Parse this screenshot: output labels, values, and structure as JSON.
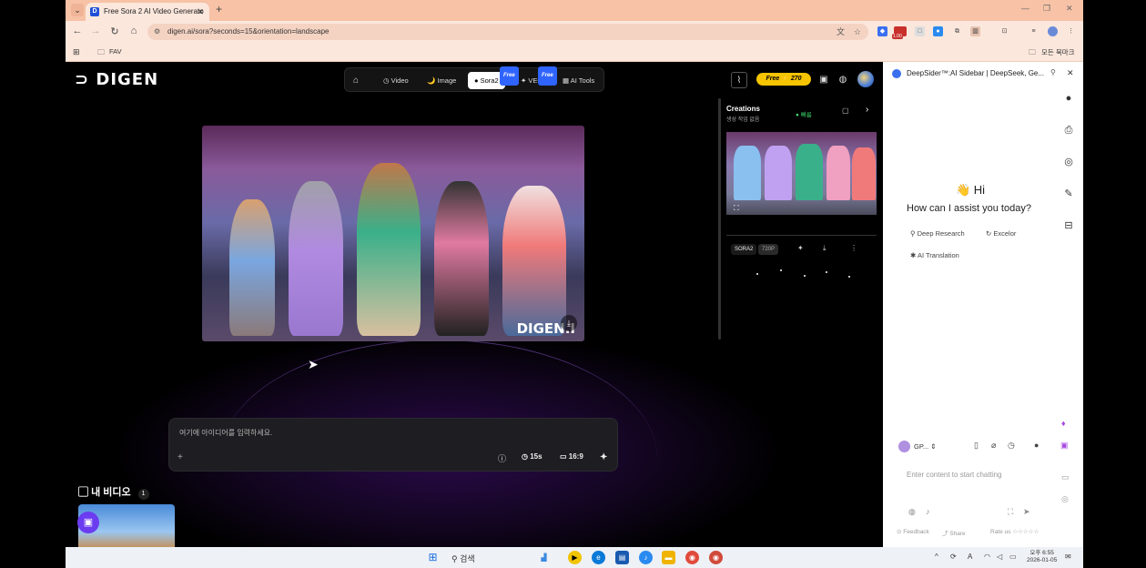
{
  "browser": {
    "tab_title": "Free Sora 2 AI Video Generato",
    "tab_close": "✕",
    "new_tab": "+",
    "url": "digen.ai/sora?seconds=15&orientation=landscape",
    "bookmarks": [
      {
        "label": "FAV"
      }
    ],
    "bookmarks_right": "모든 북마크",
    "ext_badge": "1.00"
  },
  "site": {
    "logo": "DIGEN",
    "nav": [
      {
        "label": "Video"
      },
      {
        "label": "Image"
      },
      {
        "label": "Sora2",
        "badge": "Free"
      },
      {
        "label": "VEO",
        "badge": "Free"
      },
      {
        "label": "AI Tools"
      }
    ],
    "credits": "Free ⚡ 270",
    "watermark": "DIGEN.I"
  },
  "prompt": {
    "placeholder": "여기에 아이디어를 입력하세요.",
    "duration": "15s",
    "ratio": "16:9"
  },
  "my_videos": {
    "title": "내 비디오",
    "count": "1"
  },
  "creations": {
    "title": "Creations",
    "subtitle": "생성 작업 없음",
    "status": "● 빠름",
    "tags": [
      "SORA2",
      "720P"
    ]
  },
  "sidebar": {
    "title": "DeepSider™:AI Sidebar | DeepSeek, Ge...",
    "greeting": "👋 Hi",
    "question": "How can I assist you today?",
    "chips": [
      "Deep Research",
      "Excelor",
      "AI Translation"
    ],
    "model": "GP...",
    "input_placeholder": "Enter content to start chatting",
    "feedback": "Feedback",
    "share": "Share",
    "rate": "Rate us"
  },
  "taskbar": {
    "search": "검색",
    "time": "오후 6:55",
    "date": "2026-01-05"
  },
  "colors": {
    "accent_purple": "#6b3cf0",
    "credit_yellow": "#f6c400",
    "free_badge": "#2f64ff",
    "tab_bg": "#f7c2a6"
  }
}
